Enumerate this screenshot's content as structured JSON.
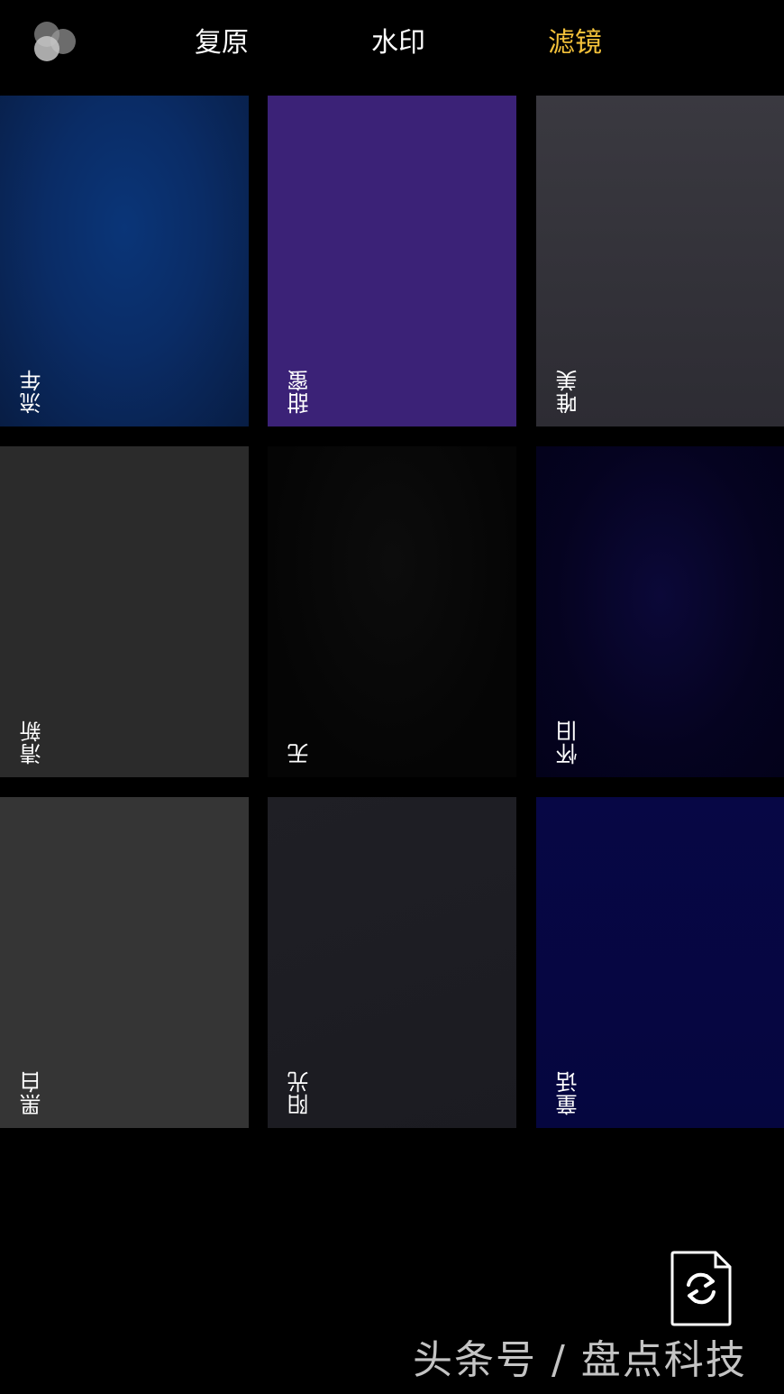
{
  "topbar": {
    "tabs": [
      {
        "label": "复原"
      },
      {
        "label": "水印"
      },
      {
        "label": "滤镜"
      }
    ],
    "active_color": "#f3c13a"
  },
  "filters": [
    {
      "label": "流年"
    },
    {
      "label": "甜蜜"
    },
    {
      "label": "唯美"
    },
    {
      "label": "清新"
    },
    {
      "label": "无"
    },
    {
      "label": "怀旧"
    },
    {
      "label": "黑白"
    },
    {
      "label": "阳光"
    },
    {
      "label": "童话"
    }
  ],
  "icons": {
    "filter_toggle": "filter-circles-icon",
    "rotate": "rotate-camera-icon"
  },
  "watermark": "头条号 / 盘点科技"
}
